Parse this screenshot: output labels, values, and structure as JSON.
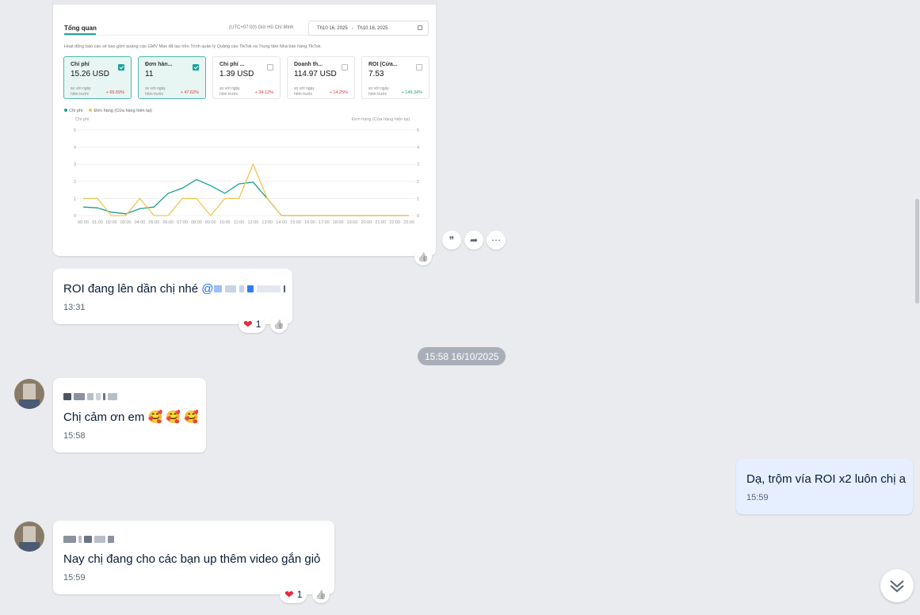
{
  "screenshot": {
    "tab": "Tổng quan",
    "timezone": "(UTC+07:00) Giờ Hồ Chí Minh",
    "date_from": "Th10 16, 2025",
    "date_sep": "-",
    "date_to": "Th10 16, 2025",
    "description": "Hoạt động báo cáo sẽ bao gồm quảng cáo GMV Max đã tạo trên Trình quản lý Quảng cáo TikTok và Trung tâm Nhà bán hàng TikTok.",
    "kpis": [
      {
        "title": "Chi phí",
        "value": "15.26 USD",
        "cmp1": "so với ngày",
        "cmp2": "hôm trước",
        "delta": "+ 65.59%",
        "delta_color": "#d83a3a",
        "selected": true
      },
      {
        "title": "Đơn hàn...",
        "value": "11",
        "cmp1": "so với ngày",
        "cmp2": "hôm trước",
        "delta": "+ 47.62%",
        "delta_color": "#d83a3a",
        "selected": true
      },
      {
        "title": "Chi phí ...",
        "value": "1.39 USD",
        "cmp1": "so với ngày",
        "cmp2": "hôm trước",
        "delta": "+ 34.12%",
        "delta_color": "#d83a3a",
        "selected": false
      },
      {
        "title": "Doanh th...",
        "value": "114.97 USD",
        "cmp1": "so với ngày",
        "cmp2": "hôm trước",
        "delta": "+ 14.25%",
        "delta_color": "#d83a3a",
        "selected": false
      },
      {
        "title": "ROI (Cửa...",
        "value": "7.53",
        "cmp1": "so với ngày",
        "cmp2": "hôm trước",
        "delta": "+ 149.34%",
        "delta_color": "#1aa564",
        "selected": false
      }
    ],
    "legend_cost": "Chi phí",
    "legend_orders": "Đơn hàng (Cửa hàng hiện tại)",
    "left_axis_title": "Chi phí",
    "right_axis_title": "Đơn hàng (Cửa hàng hiện tại)"
  },
  "chart_data": {
    "type": "line",
    "x": [
      "00:00",
      "01:00",
      "02:00",
      "03:00",
      "04:00",
      "05:00",
      "06:00",
      "07:00",
      "08:00",
      "09:00",
      "10:00",
      "11:00",
      "12:00",
      "13:00",
      "14:00",
      "15:00",
      "16:00",
      "17:00",
      "18:00",
      "19:00",
      "20:00",
      "21:00",
      "22:00",
      "23:00"
    ],
    "ylim": [
      0,
      5
    ],
    "y_ticks": [
      0,
      1,
      2,
      3,
      4,
      5
    ],
    "series": [
      {
        "name": "Chi phí",
        "color": "#1a9e8f",
        "values": [
          0.5,
          0.45,
          0.2,
          0.1,
          0.4,
          0.5,
          1.3,
          1.6,
          2.1,
          1.75,
          1.3,
          1.85,
          1.95,
          1.0,
          0,
          0,
          0,
          0,
          0,
          0,
          0,
          0,
          0,
          0
        ]
      },
      {
        "name": "Đơn hàng (Cửa hàng hiện tại)",
        "color": "#f0c552",
        "values": [
          1,
          1,
          0,
          0,
          1,
          0,
          0,
          1,
          1,
          0,
          1,
          1,
          3,
          1,
          0,
          0,
          0,
          0,
          0,
          0,
          0,
          0,
          0,
          0
        ]
      }
    ]
  },
  "msg_roi": {
    "text": "ROI đang lên dần chị nhé ",
    "mention": "@",
    "time": "13:31",
    "reaction_count": "1"
  },
  "divider": "15:58 16/10/2025",
  "msg_thanks": {
    "text": "Chị cảm ơn em ",
    "emoji": "🥰 🥰 🥰",
    "time": "15:58"
  },
  "msg_mine": {
    "text": "Dạ, trộm vía ROI x2 luôn chị a",
    "time": "15:59"
  },
  "msg_video": {
    "text": "Nay chị đang cho các bạn up thêm video gắn giỏ",
    "time": "15:59",
    "reaction_count": "1"
  },
  "icons": {
    "quote": "❞",
    "share": "➦",
    "more": "⋯",
    "like": "👍",
    "heart": "❤"
  }
}
